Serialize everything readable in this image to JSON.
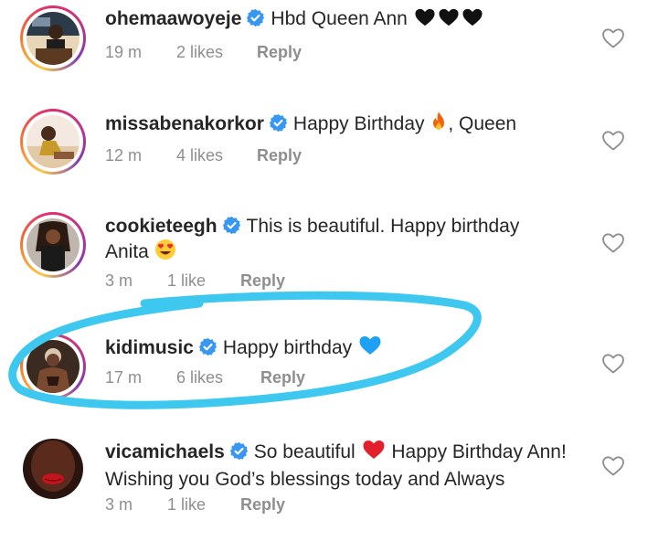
{
  "comments": [
    {
      "username": "ohemaawoyeje",
      "text": "Hbd Queen Ann",
      "emoji": "black-hearts",
      "time": "19 m",
      "likes": "2 likes",
      "reply": "Reply"
    },
    {
      "username": "missabenakorkor",
      "text": "Happy Birthday",
      "text_after": ", Queen",
      "emoji": "fire",
      "time": "12 m",
      "likes": "4 likes",
      "reply": "Reply"
    },
    {
      "username": "cookieteegh",
      "text": "This is beautiful. Happy birthday Anita",
      "emoji": "heart-eyes",
      "time": "3 m",
      "likes": "1 like",
      "reply": "Reply"
    },
    {
      "username": "kidimusic",
      "text": "Happy birthday",
      "emoji": "blue-heart",
      "time": "17 m",
      "likes": "6 likes",
      "reply": "Reply"
    },
    {
      "username": "vicamichaels",
      "text": "So beautiful",
      "emoji": "red-heart",
      "text_after": " Happy Birthday Ann! Wishing you God’s blessings today and Always",
      "time": "3 m",
      "likes": "1 like",
      "reply": "Reply"
    }
  ],
  "colors": {
    "username": "#262626",
    "meta": "#8e8e8e",
    "verified": "#3897f0",
    "highlight_stroke": "#3ec8ef"
  },
  "icons": [
    "verified-badge-icon",
    "heart-outline-icon"
  ]
}
